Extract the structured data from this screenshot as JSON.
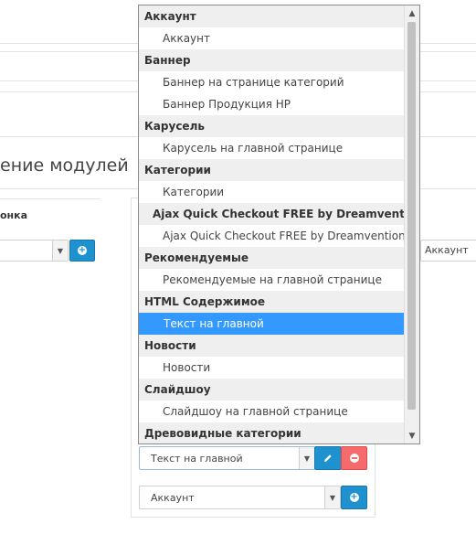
{
  "page": {
    "title": "ение модулей",
    "column_label": "онка"
  },
  "left_row": {
    "select_value": ""
  },
  "right_row": {
    "select_value": "Аккаунт"
  },
  "bottom_rows": [
    {
      "select_value": "Текст на главной"
    },
    {
      "select_value": "Аккаунт"
    }
  ],
  "dropdown": {
    "options": [
      {
        "kind": "group",
        "label": "Аккаунт"
      },
      {
        "kind": "item",
        "label": "Аккаунт"
      },
      {
        "kind": "group",
        "label": "Баннер"
      },
      {
        "kind": "item",
        "label": "Баннер на странице категорий"
      },
      {
        "kind": "item",
        "label": "Баннер Продукция HP"
      },
      {
        "kind": "group",
        "label": "Карусель"
      },
      {
        "kind": "item",
        "label": "Карусель на главной странице"
      },
      {
        "kind": "group",
        "label": "Категории"
      },
      {
        "kind": "item",
        "label": "Категории"
      },
      {
        "kind": "group",
        "label": "Ajax Quick Checkout FREE by Dreamvention",
        "indent": true
      },
      {
        "kind": "item",
        "label": "Ajax Quick Checkout FREE by Dreamvention"
      },
      {
        "kind": "group",
        "label": "Рекомендуемые"
      },
      {
        "kind": "item",
        "label": "Рекомендуемые на главной странице"
      },
      {
        "kind": "group",
        "label": "HTML Содержимое"
      },
      {
        "kind": "item",
        "label": "Текст на главной",
        "selected": true
      },
      {
        "kind": "group",
        "label": "Новости"
      },
      {
        "kind": "item",
        "label": "Новости"
      },
      {
        "kind": "group",
        "label": "Слайдшоу"
      },
      {
        "kind": "item",
        "label": "Слайдшоу на главной странице"
      },
      {
        "kind": "group",
        "label": "Древовидные категории"
      }
    ]
  },
  "colors": {
    "accent_blue": "#1e91cf",
    "danger_red": "#f56b6b",
    "selected_option": "#3399ff"
  },
  "icons": {
    "add": "plus-circle-icon",
    "edit": "pencil-icon",
    "remove": "minus-circle-icon",
    "dropdown": "chevron-down-icon"
  }
}
